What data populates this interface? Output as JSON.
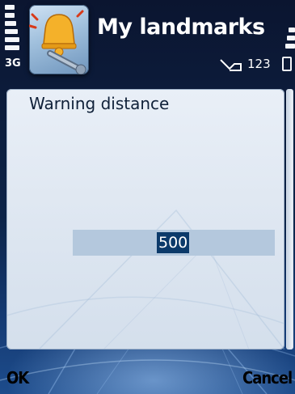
{
  "status": {
    "network_label": "3G",
    "indicator_text": "123"
  },
  "title_pane": {
    "title": "My landmarks",
    "app_icon": "landmark-bell-wrench-icon"
  },
  "dialog": {
    "title": "Warning distance",
    "value": "500"
  },
  "softkeys": {
    "left": "OK",
    "right": "Cancel"
  },
  "icons": {
    "signal": "signal-strength-icon",
    "battery": "battery-level-icon",
    "message": "message-indicator-icon"
  }
}
